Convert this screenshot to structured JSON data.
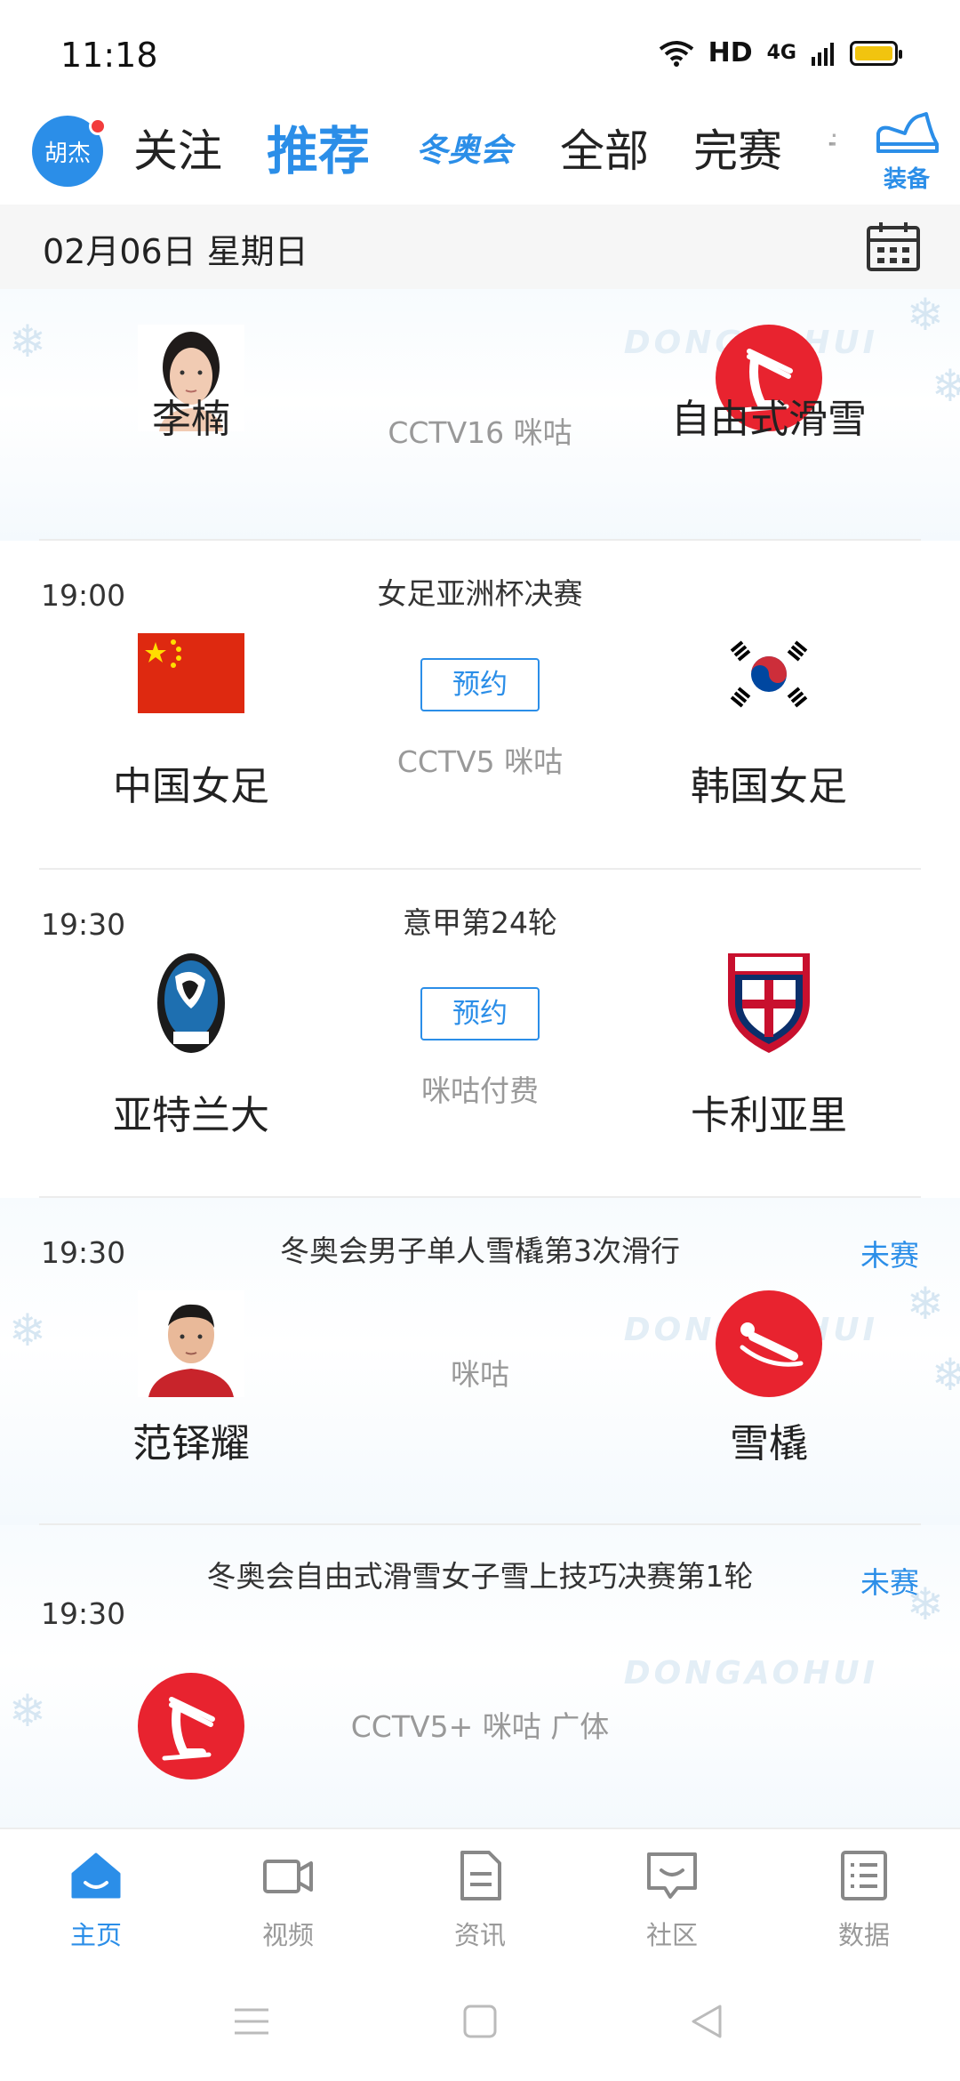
{
  "status_bar": {
    "time": "11:18",
    "network": "HD",
    "cellular": "4G",
    "battery_color": "#f1c40f"
  },
  "top_nav": {
    "avatar_text": "胡杰",
    "tabs": [
      {
        "label": "关注",
        "active": false
      },
      {
        "label": "推荐",
        "active": true
      },
      {
        "label": "冬奥会",
        "active": false,
        "style": "brand"
      },
      {
        "label": "全部",
        "active": false
      },
      {
        "label": "完赛",
        "active": false
      },
      {
        "label": "专",
        "active": false
      }
    ],
    "gear_label": "装备",
    "accent_color": "#2b8ee8"
  },
  "date_bar": {
    "date_text": "02月06日 星期日",
    "calendar_icon": "calendar-icon"
  },
  "matches": [
    {
      "time": "",
      "title": "",
      "status": "",
      "left_name": "李楠",
      "left_icon": "athlete-avatar-female",
      "right_name": "自由式滑雪",
      "right_icon": "freestyle-skiing-icon",
      "channel": "CCTV16 咪咕",
      "reserve_label": ""
    },
    {
      "time": "19:00",
      "title": "女足亚洲杯决赛",
      "status": "",
      "left_name": "中国女足",
      "left_icon": "china-flag-icon",
      "right_name": "韩国女足",
      "right_icon": "korea-flag-icon",
      "channel": "CCTV5 咪咕",
      "reserve_label": "预约"
    },
    {
      "time": "19:30",
      "title": "意甲第24轮",
      "status": "",
      "left_name": "亚特兰大",
      "left_icon": "atalanta-crest-icon",
      "right_name": "卡利亚里",
      "right_icon": "cagliari-crest-icon",
      "channel": "咪咕付费",
      "reserve_label": "预约"
    },
    {
      "time": "19:30",
      "title": "冬奥会男子单人雪橇第3次滑行",
      "status": "未赛",
      "left_name": "范铎耀",
      "left_icon": "athlete-avatar-male",
      "right_name": "雪橇",
      "right_icon": "luge-icon",
      "channel": "咪咕",
      "reserve_label": ""
    },
    {
      "time": "19:30",
      "title": "冬奥会自由式滑雪女子雪上技巧决赛第1轮",
      "status": "未赛",
      "left_name": "",
      "left_icon": "freestyle-skiing-icon",
      "right_name": "",
      "right_icon": "",
      "channel": "CCTV5+ 咪咕 广体",
      "reserve_label": ""
    }
  ],
  "bottom_nav": [
    {
      "label": "主页",
      "icon": "home-icon",
      "active": true
    },
    {
      "label": "视频",
      "icon": "video-camera-icon",
      "active": false
    },
    {
      "label": "资讯",
      "icon": "news-document-icon",
      "active": false
    },
    {
      "label": "社区",
      "icon": "chat-bubble-icon",
      "active": false
    },
    {
      "label": "数据",
      "icon": "data-list-icon",
      "active": false
    }
  ]
}
